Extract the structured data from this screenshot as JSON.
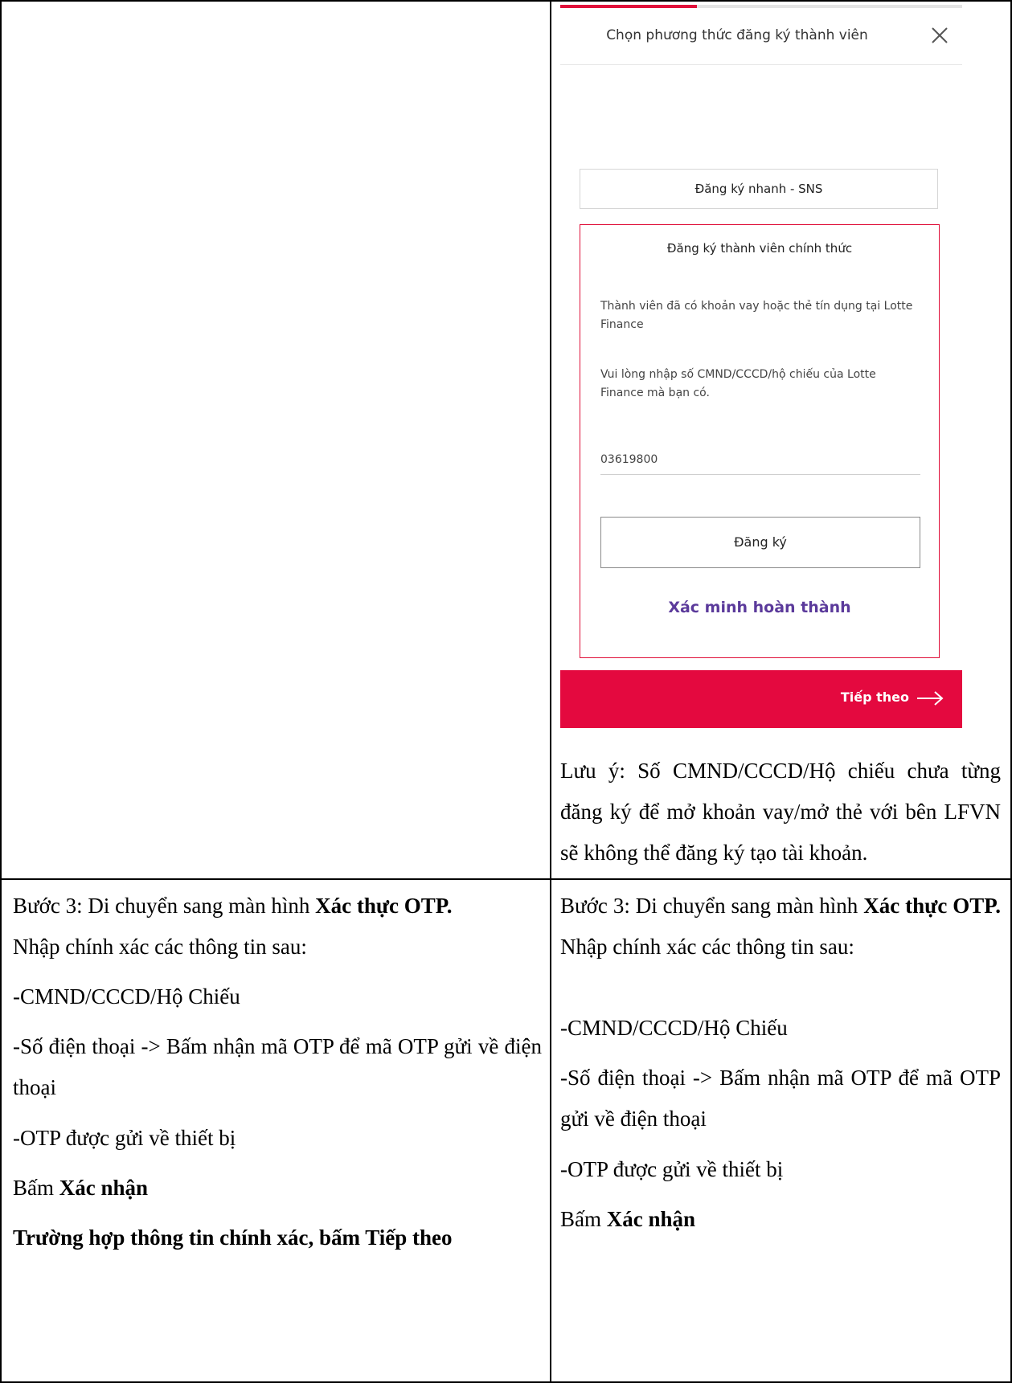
{
  "phone": {
    "modal_title": "Chọn phương thức đăng ký thành viên",
    "sns_button": "Đăng ký nhanh - SNS",
    "official_title": "Đăng ký thành viên chính thức",
    "official_desc_1": "Thành viên đã có khoản vay hoặc thẻ tín dụng tại Lotte Finance",
    "official_desc_2": "Vui lòng nhập số CMND/CCCD/hộ chiếu của Lotte Finance mà bạn có.",
    "id_value": "03619800",
    "register_button": "Đăng ký",
    "verified_text": "Xác minh hoàn thành",
    "next_button": "Tiếp theo",
    "accent_color": "#e4093f",
    "verified_color": "#5b3a9b"
  },
  "note": "Lưu ý: Số CMND/CCCD/Hộ chiếu chưa từng đăng ký để mở khoản vay/mở thẻ với bên LFVN sẽ không thể đăng ký tạo tài khoản.",
  "left_step": {
    "step_prefix": "Bước 3: Di chuyển sang màn hình ",
    "step_bold": "Xác thực OTP.",
    "intro": "Nhập chính xác các thông tin sau:",
    "item_1": "-CMND/CCCD/Hộ Chiếu",
    "item_2": "-Số điện thoại -> Bấm nhận mã OTP để mã OTP gửi về điện thoại",
    "item_3": "-OTP được gửi về thiết bị",
    "confirm_prefix": "Bấm ",
    "confirm_bold": "Xác nhận",
    "final_bold": "Trường hợp thông tin chính xác, bấm Tiếp theo"
  },
  "right_step": {
    "step_prefix": "Bước 3: Di chuyển sang màn hình ",
    "step_bold": "Xác thực OTP.",
    "intro": " Nhập chính xác các thông tin sau:",
    "item_1": "-CMND/CCCD/Hộ Chiếu",
    "item_2": "-Số điện thoại -> Bấm nhận mã OTP để mã OTP gửi về điện thoại",
    "item_3": "-OTP được gửi về thiết bị",
    "confirm_prefix": "Bấm ",
    "confirm_bold": "Xác nhận"
  }
}
